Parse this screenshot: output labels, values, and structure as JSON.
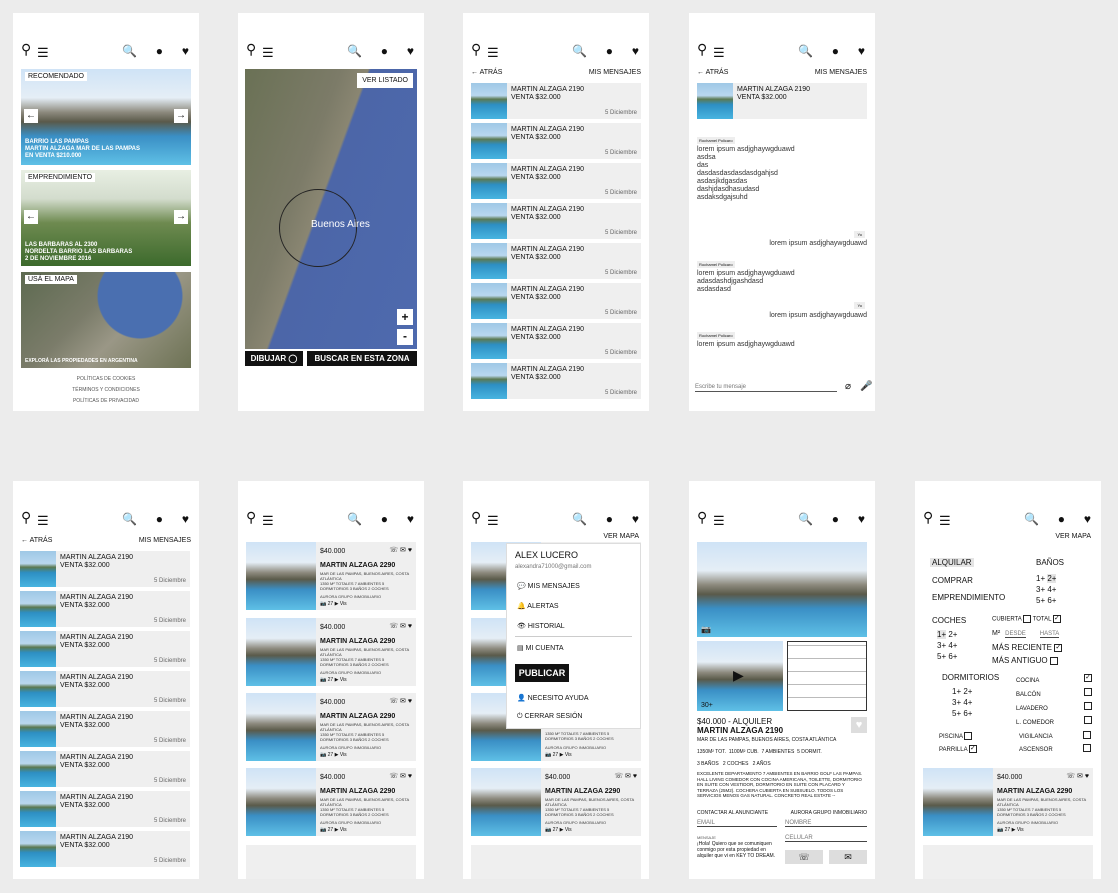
{
  "icons": {
    "logo": "⚲",
    "menu": "☰",
    "search": "🔍",
    "user": "●",
    "heart": "♥",
    "back": "←",
    "phone": "☏",
    "mail": "✉",
    "fav": "♥"
  },
  "nav": {
    "back": "ATRÁS",
    "messages": "MIS MENSAJES",
    "see_map": "VER MAPA"
  },
  "home": {
    "rec_tag": "RECOMENDADO",
    "rec_caption": [
      "BARRIO LAS PAMPAS",
      "MARTIN ALZAGA MAR DE LAS PAMPAS",
      "EN VENTA $210.000"
    ],
    "emp_tag": "EMPRENDIMIENTO",
    "emp_caption": [
      "LAS BARBARAS AL 2300",
      "NORDELTA BARRIO LAS BARBARAS",
      "2 DE NOVIEMBRE 2016"
    ],
    "map_tag": "USÁ EL MAPA",
    "map_caption": "EXPLORÁ LAS PROPIEDADES EN ARGENTINA",
    "footer": [
      "POLÍTICAS DE COOKIES",
      "TÉRMINOS Y CONDICIONES",
      "POLÍTICAS DE PRIVACIDAD"
    ]
  },
  "map": {
    "see_list": "VER LISTADO",
    "city": "Buenos Aires",
    "zoom_in": "+",
    "zoom_out": "-",
    "draw": "DIBUJAR",
    "search_zone": "BUSCAR EN ESTA ZONA"
  },
  "messages_list": [
    {
      "title": "MARTIN ALZAGA 2190",
      "sub": "VENTA $32.000",
      "date": "5 Diciembre"
    },
    {
      "title": "MARTIN ALZAGA 2190",
      "sub": "VENTA $32.000",
      "date": "5 Diciembre"
    },
    {
      "title": "MARTIN ALZAGA 2190",
      "sub": "VENTA $32.000",
      "date": "5 Diciembre"
    },
    {
      "title": "MARTIN ALZAGA 2190",
      "sub": "VENTA $32.000",
      "date": "5 Diciembre"
    },
    {
      "title": "MARTIN ALZAGA 2190",
      "sub": "VENTA $32.000",
      "date": "5 Diciembre"
    },
    {
      "title": "MARTIN ALZAGA 2190",
      "sub": "VENTA $32.000",
      "date": "5 Diciembre"
    },
    {
      "title": "MARTIN ALZAGA 2190",
      "sub": "VENTA $32.000",
      "date": "5 Diciembre"
    },
    {
      "title": "MARTIN ALZAGA 2190",
      "sub": "VENTA $32.000",
      "date": "5 Diciembre"
    }
  ],
  "chat": {
    "head_title": "MARTIN ALZAGA 2190",
    "head_sub": "VENTA $32.000",
    "sender": "Rochamel Policaro",
    "me": "Yo",
    "msg1": [
      "lorem ipsum asdjghaywgduawd",
      "asdsa",
      "das",
      "dasdasdasdasdasdgahjsd",
      "asdasjkdgasdas",
      "dashjdasdhasudasd",
      "asdaksdgajsuhd"
    ],
    "reply1": "lorem ipsum asdjghaywgduawd",
    "msg2": [
      "lorem ipsum asdjghaywgduawd",
      "adasdashdjgashdasd",
      "asdasdasd"
    ],
    "reply2": "lorem ipsum asdjghaywgduawd",
    "msg3": "lorem ipsum asdjghaywgduawd",
    "placeholder": "Escribe tu mensaje"
  },
  "listing": {
    "price": "$40.000",
    "title": "MARTIN ALZAGA 2290",
    "address": "MAR DE LAS PAMPAS, BUENOS AIRES, COSTA ATLÁNTICA",
    "desc": "1350 M² TOTALES 7 AMBIENTES 5 DORMITORIOS 3 BAÑOS 2 COCHES",
    "agency": "AURORA GRUPO INMOBILIARIO",
    "photos": "27",
    "video": "Vis"
  },
  "user_menu": {
    "name": "ALEX LUCERO",
    "email": "alexandra71000@gmail.com",
    "items": [
      "MIS MENSAJES",
      "ALERTAS",
      "HISTORIAL",
      "MI CUENTA"
    ],
    "publish": "PUBLICAR",
    "help": "NECESITO AYUDA",
    "logout": "CERRAR SESIÓN"
  },
  "detail": {
    "price": "$40.000 - ALQUILER",
    "title": "MARTIN ALZAGA 2190",
    "address": "MAR DE LAS PAMPAS, BUENOS AIRES, COSTA ATLÁNTICA",
    "feat": [
      "1350M² TOT.",
      "1100M² CUB.",
      "7 AMBIENTES",
      "5 DORMIT.",
      "3 BAÑOS",
      "2 COCHES",
      "2 AÑOS"
    ],
    "text": "EXCELENTE DEPARTAMENTO 7 AMBIENTES EN BARRIO GOLF LAS PAMPAS. HALL LIVING COMEDOR CON COCINA AMERICANA, TOILETTE, DORMITORIO EN SUITE CON VESTIDOR, DORMITORIO EN SUITE CON PLACARD Y TERRAZA (25M2). COCHERA CUBIERTA EN SUBSUELO. TODOS LOS SERVICIOS MENOS GAS NATURAL. CONCRETO REAL ESTATE --",
    "contact": "CONTACTAR AL ANUNCIANTE",
    "agency": "AURORA GRUPO INMOBILIARIO",
    "email": "EMAIL",
    "name": "NOMBRE",
    "msg_label": "MENSAJE",
    "cell": "CELULAR",
    "msg": "¡Hola! Quiero que se comuniquen conmigo por esta propiedad en alquiler que vi en KEY TO DREAM.",
    "gallery_count": "30+"
  },
  "filters": {
    "ops": [
      "ALQUILAR",
      "COMPRAR",
      "EMPRENDIMIENTO"
    ],
    "banos_label": "BAÑOS",
    "banos": [
      "1+",
      "2+",
      "3+",
      "4+",
      "5+",
      "6+"
    ],
    "coches_label": "COCHES",
    "coches": [
      "1+",
      "2+",
      "3+",
      "4+",
      "5+",
      "6+"
    ],
    "cubierta": "CUBIERTA",
    "total": "TOTAL",
    "m2": "M²",
    "desde": "DESDE",
    "hasta": "HASTA",
    "reciente": "MÁS RECIENTE",
    "antiguo": "MÁS ANTIGUO",
    "dorm_label": "DORMITORIOS",
    "dorm": [
      "1+",
      "2+",
      "3+",
      "4+",
      "5+",
      "6+"
    ],
    "amen": [
      "COCINA",
      "BALCÓN",
      "LAVADERO",
      "L. COMEDOR"
    ],
    "pileta": "PISCINA",
    "parrilla": "PARRILLA",
    "vig": "VIGILANCIA",
    "asc": "ASCENSOR"
  }
}
